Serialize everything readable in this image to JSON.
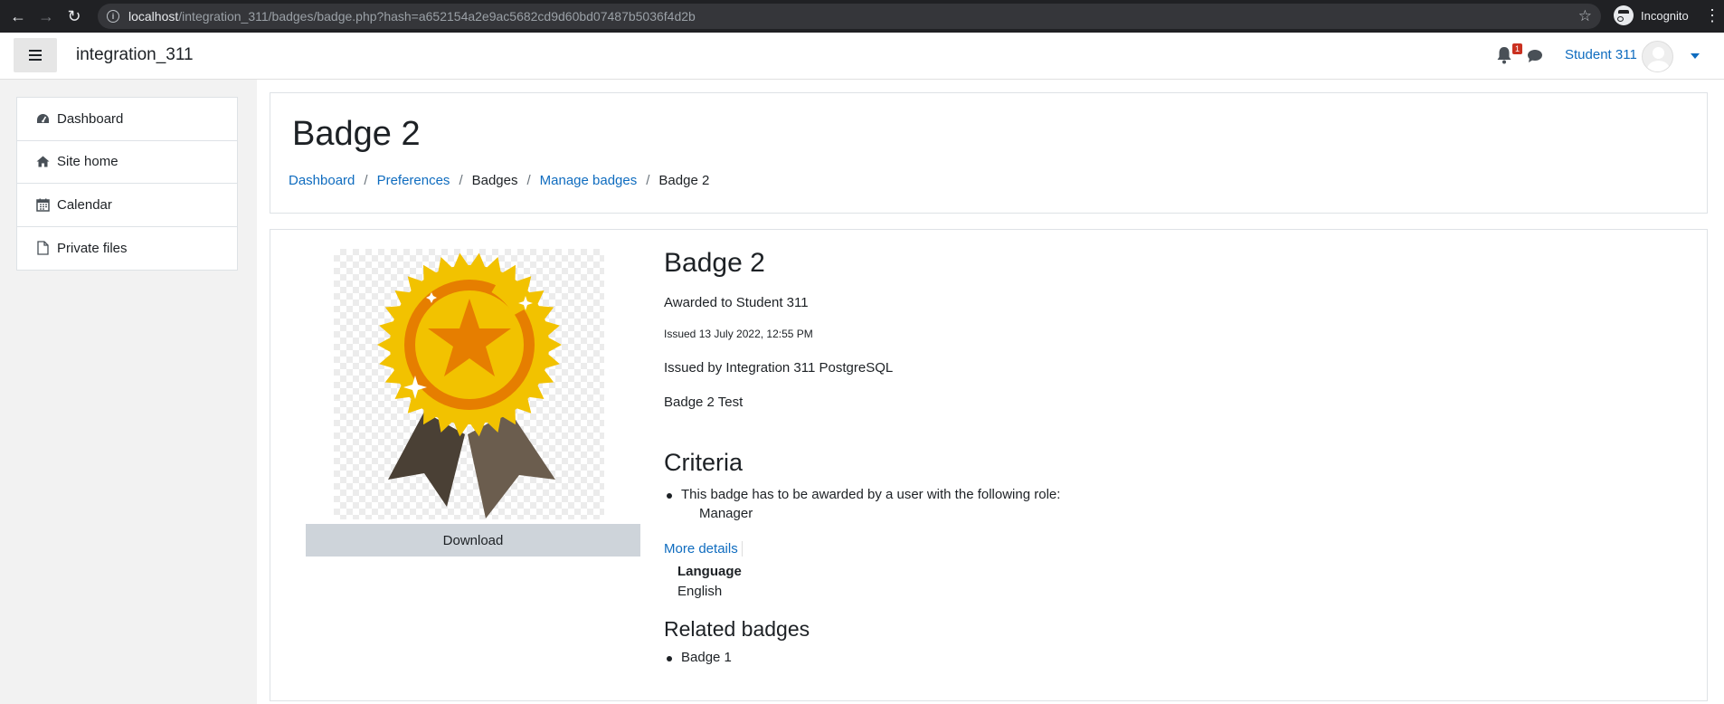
{
  "browser": {
    "url_host": "localhost",
    "url_path": "/integration_311/badges/badge.php?hash=a652154a2e9ac5682cd9d60bd07487b5036f4d2b",
    "incognito_label": "Incognito"
  },
  "navbar": {
    "site_name": "integration_311",
    "notification_count": "1",
    "user_name": "Student 311"
  },
  "drawer": {
    "items": [
      {
        "label": "Dashboard",
        "icon": "dashboard-icon"
      },
      {
        "label": "Site home",
        "icon": "home-icon"
      },
      {
        "label": "Calendar",
        "icon": "calendar-icon"
      },
      {
        "label": "Private files",
        "icon": "file-icon"
      }
    ]
  },
  "header": {
    "title": "Badge 2",
    "breadcrumb": [
      {
        "label": "Dashboard",
        "link": true
      },
      {
        "label": "Preferences",
        "link": true
      },
      {
        "label": "Badges",
        "link": false
      },
      {
        "label": "Manage badges",
        "link": true
      },
      {
        "label": "Badge 2",
        "link": false
      }
    ]
  },
  "badge": {
    "download_label": "Download",
    "title": "Badge 2",
    "awarded_to": "Awarded to Student 311",
    "issued_date": "Issued 13 July 2022, 12:55 PM",
    "issuer": "Issued by Integration 311 PostgreSQL",
    "description": "Badge 2 Test",
    "criteria_heading": "Criteria",
    "criteria_text": "This badge has to be awarded by a user with the following role:",
    "criteria_role": "Manager",
    "more_details_label": "More details",
    "language_label": "Language",
    "language_value": "English",
    "related_heading": "Related badges",
    "related": [
      "Badge 1"
    ]
  },
  "colors": {
    "link": "#0f6cbf",
    "badge_gold": "#f2c200",
    "badge_orange": "#e67e00",
    "ribbon_dark": "#4a4035",
    "ribbon_light": "#6b5d4e"
  }
}
